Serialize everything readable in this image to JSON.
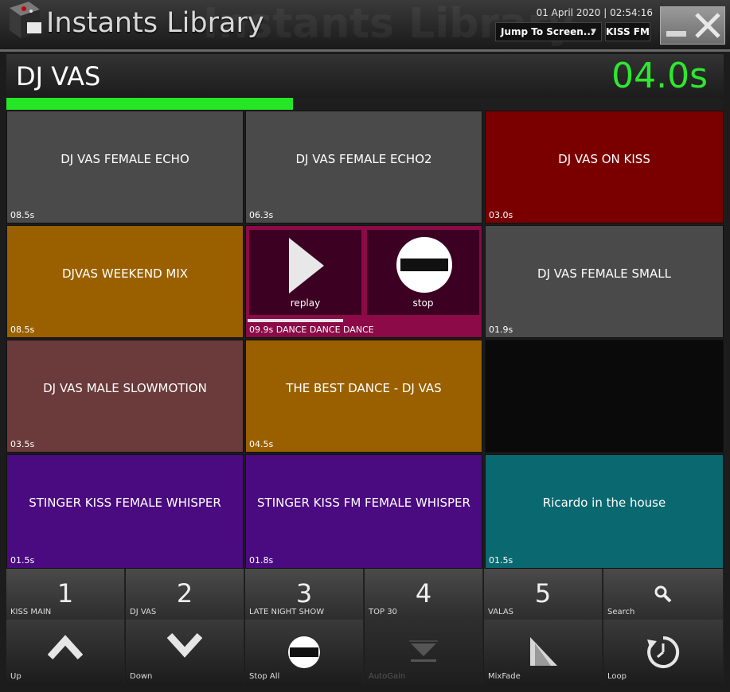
{
  "app": {
    "title": "Instants Library",
    "datetime": "01 April 2020 | 02:54:16",
    "jump_label": "Jump To Screen...",
    "station": "KISS FM"
  },
  "now_playing": {
    "title": "DJ VAS",
    "remaining": "04.0s",
    "progress_fraction": 0.4,
    "color_accent": "#26e626"
  },
  "cells": [
    {
      "label": "DJ VAS FEMALE ECHO",
      "duration": "08.5s",
      "color": "#4a4a4a"
    },
    {
      "label": "DJ VAS FEMALE ECHO2",
      "duration": "06.3s",
      "color": "#4a4a4a"
    },
    {
      "label": "DJ VAS ON KISS",
      "duration": "03.0s",
      "color": "#7a0000"
    },
    {
      "label": "DJVAS WEEKEND MIX",
      "duration": "08.5s",
      "color": "#9a6000"
    },
    {
      "label": "",
      "duration": "",
      "color": "#8b0a47"
    },
    {
      "label": "DJ VAS FEMALE SMALL",
      "duration": "01.9s",
      "color": "#4a4a4a"
    },
    {
      "label": "DJ VAS MALE SLOWMOTION",
      "duration": "03.5s",
      "color": "#6b3a3a"
    },
    {
      "label": "THE BEST DANCE - DJ VAS",
      "duration": "04.5s",
      "color": "#9a6000"
    },
    {
      "label": "",
      "duration": "",
      "color": "#0a0a0a"
    },
    {
      "label": "STINGER KISS FEMALE WHISPER",
      "duration": "01.5s",
      "color": "#4a0a80"
    },
    {
      "label": "STINGER KISS FM FEMALE WHISPER",
      "duration": "01.8s",
      "color": "#4a0a80"
    },
    {
      "label": "Ricardo in the house",
      "duration": "01.5s",
      "color": "#0a6870"
    }
  ],
  "active_cell": {
    "replay_label": "replay",
    "stop_label": "stop",
    "info": "09.9s DANCE DANCE DANCE",
    "progress_fraction": 0.4
  },
  "tabs": [
    {
      "number": "1",
      "name": "KISS MAIN"
    },
    {
      "number": "2",
      "name": "DJ VAS"
    },
    {
      "number": "3",
      "name": "LATE NIGHT SHOW"
    },
    {
      "number": "4",
      "name": "TOP 30"
    },
    {
      "number": "5",
      "name": "VALAS"
    },
    {
      "number": "",
      "name": "Search",
      "icon": "search-icon"
    }
  ],
  "controls": [
    {
      "name": "Up",
      "icon": "chevron-up-icon"
    },
    {
      "name": "Down",
      "icon": "chevron-down-icon"
    },
    {
      "name": "Stop All",
      "icon": "stop-icon"
    },
    {
      "name": "AutoGain",
      "icon": "autogain-icon",
      "disabled": true
    },
    {
      "name": "MixFade",
      "icon": "mixfade-icon"
    },
    {
      "name": "Loop",
      "icon": "loop-icon"
    }
  ]
}
